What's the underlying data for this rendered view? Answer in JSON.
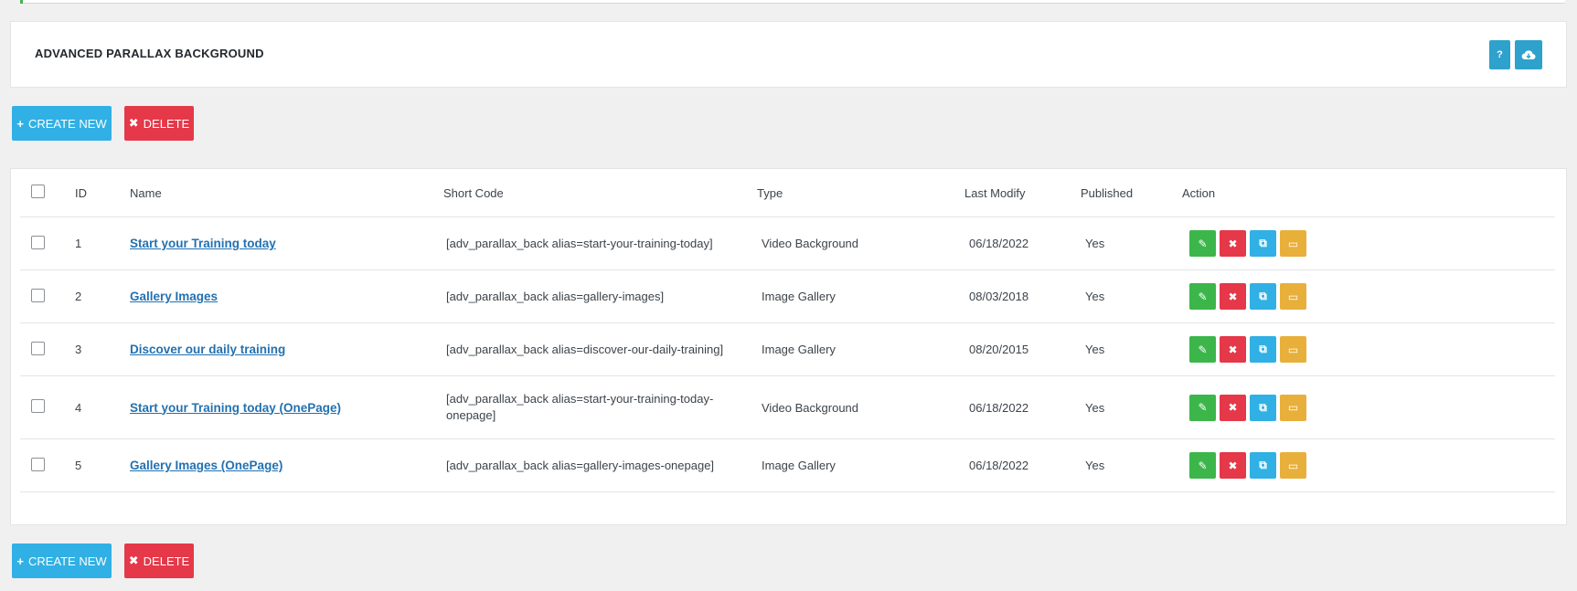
{
  "header": {
    "title": "ADVANCED PARALLAX BACKGROUND",
    "help_label": "?",
    "help_icon": "question-icon",
    "cloud_icon": "cloud-download-icon"
  },
  "toolbar": {
    "create_label": "CREATE NEW",
    "create_icon": "+",
    "delete_label": "DELETE",
    "delete_icon": "✖"
  },
  "table": {
    "columns": [
      "ID",
      "Name",
      "Short Code",
      "Type",
      "Last Modify",
      "Published",
      "Action"
    ],
    "rows": [
      {
        "id": "1",
        "name": "Start your Training today",
        "shortcode": "[adv_parallax_back alias=start-your-training-today]",
        "type": "Video Background",
        "modified": "06/18/2022",
        "published": "Yes"
      },
      {
        "id": "2",
        "name": "Gallery Images",
        "shortcode": "[adv_parallax_back alias=gallery-images]",
        "type": "Image Gallery",
        "modified": "08/03/2018",
        "published": "Yes"
      },
      {
        "id": "3",
        "name": "Discover our daily training",
        "shortcode": "[adv_parallax_back alias=discover-our-daily-training]",
        "type": "Image Gallery",
        "modified": "08/20/2015",
        "published": "Yes"
      },
      {
        "id": "4",
        "name": "Start your Training today (OnePage)",
        "shortcode": "[adv_parallax_back alias=start-your-training-today-onepage]",
        "type": "Video Background",
        "modified": "06/18/2022",
        "published": "Yes"
      },
      {
        "id": "5",
        "name": "Gallery Images (OnePage)",
        "shortcode": "[adv_parallax_back alias=gallery-images-onepage]",
        "type": "Image Gallery",
        "modified": "06/18/2022",
        "published": "Yes"
      }
    ]
  },
  "colors": {
    "create": "#30b0e4",
    "delete": "#e53848",
    "edit": "#3cb64a",
    "preview": "#e8b03b",
    "link": "#2271b1"
  }
}
